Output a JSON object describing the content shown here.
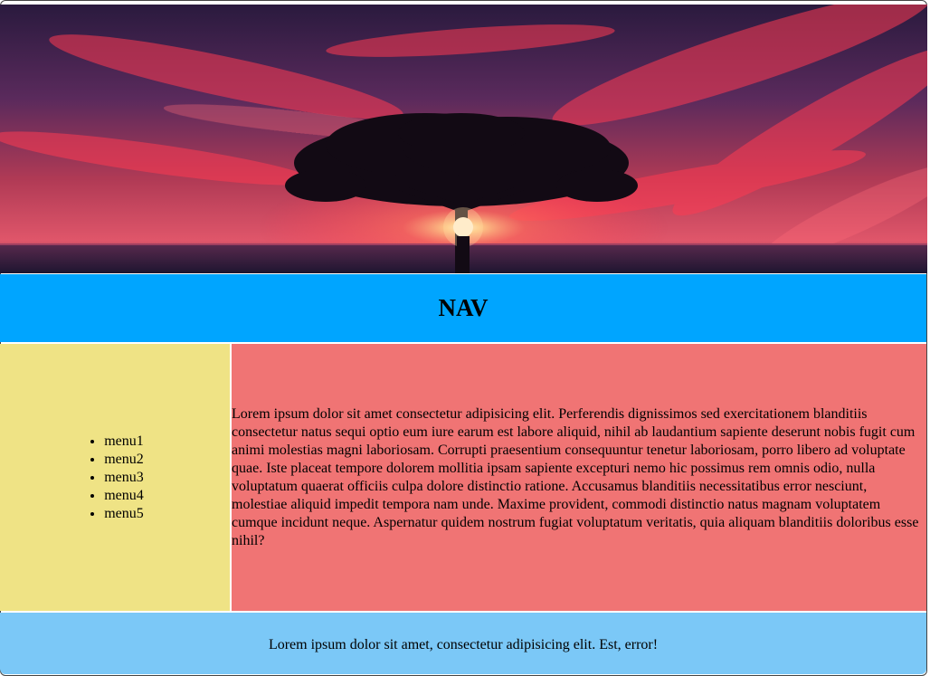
{
  "header": {
    "image": "sunset-tree-banner"
  },
  "nav": {
    "title": "NAV"
  },
  "sidebar": {
    "items": [
      {
        "label": "menu1"
      },
      {
        "label": "menu2"
      },
      {
        "label": "menu3"
      },
      {
        "label": "menu4"
      },
      {
        "label": "menu5"
      }
    ]
  },
  "main": {
    "text": "Lorem ipsum dolor sit amet consectetur adipisicing elit. Perferendis dignissimos sed exercitationem blanditiis consectetur natus sequi optio eum iure earum est labore aliquid, nihil ab laudantium sapiente deserunt nobis fugit cum animi molestias magni laboriosam. Corrupti praesentium consequuntur tenetur laboriosam, porro libero ad voluptate quae. Iste placeat tempore dolorem mollitia ipsam sapiente excepturi nemo hic possimus rem omnis odio, nulla voluptatum quaerat officiis culpa dolore distinctio ratione. Accusamus blanditiis necessitatibus error nesciunt, molestiae aliquid impedit tempora nam unde. Maxime provident, commodi distinctio natus magnam voluptatem cumque incidunt neque. Aspernatur quidem nostrum fugiat voluptatum veritatis, quia aliquam blanditiis doloribus esse nihil?"
  },
  "footer": {
    "text": "Lorem ipsum dolor sit amet, consectetur adipisicing elit. Est, error!"
  },
  "colors": {
    "nav_bg": "#00a5ff",
    "sidebar_bg": "#efe385",
    "main_bg": "#f07474",
    "footer_bg": "#7bc8f7"
  }
}
